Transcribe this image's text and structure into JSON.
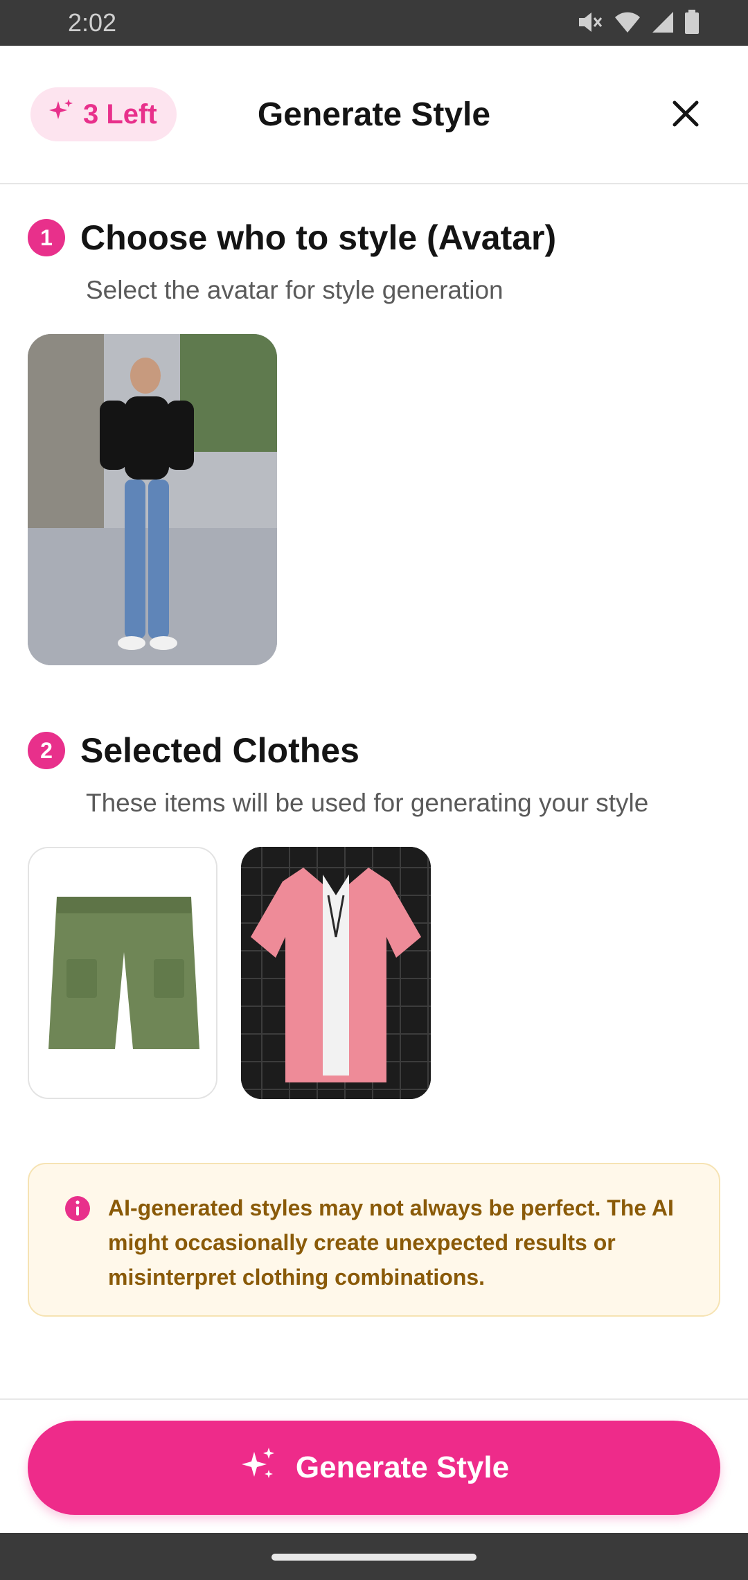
{
  "status_bar": {
    "time": "2:02",
    "icons": [
      "mute-icon",
      "wifi-icon",
      "signal-icon",
      "battery-icon"
    ]
  },
  "header": {
    "credits_label": "3 Left",
    "title": "Generate Style",
    "close_icon": "close-icon"
  },
  "section_avatar": {
    "step": "1",
    "title": "Choose who to style (Avatar)",
    "subtitle": "Select the avatar for style generation"
  },
  "section_clothes": {
    "step": "2",
    "title": "Selected Clothes",
    "subtitle": "These items will be used for generating your style"
  },
  "notice": {
    "icon": "info-icon",
    "text": "AI-generated styles may not always be perfect. The AI might occasionally create unexpected results or misinterpret clothing combinations."
  },
  "primary_action": {
    "label": "Generate Style",
    "icon": "sparkle-icon"
  },
  "colors": {
    "accent": "#ee2b8a",
    "notice_bg": "#fff8ea",
    "notice_text": "#8a5a08"
  }
}
